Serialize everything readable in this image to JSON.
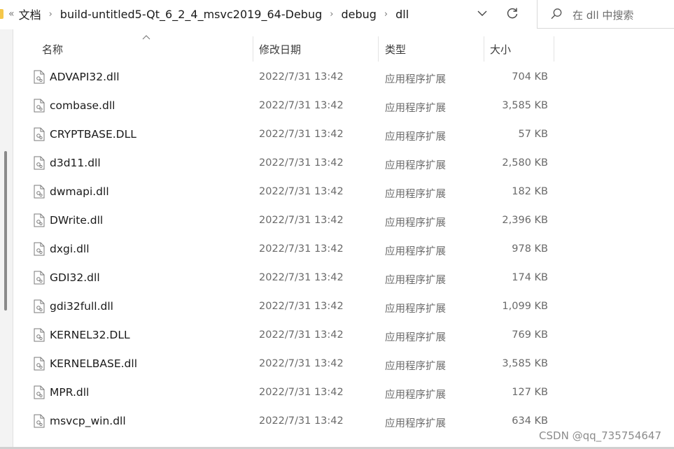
{
  "address": {
    "more": "«",
    "segments": [
      "文档",
      "build-untitled5-Qt_6_2_4_msvc2019_64-Debug",
      "debug",
      "dll"
    ]
  },
  "search": {
    "placeholder": "在 dll 中搜索"
  },
  "columns": {
    "name": "名称",
    "date": "修改日期",
    "type": "类型",
    "size": "大小"
  },
  "files": [
    {
      "name": "ADVAPI32.dll",
      "date": "2022/7/31 13:42",
      "type": "应用程序扩展",
      "size": "704 KB"
    },
    {
      "name": "combase.dll",
      "date": "2022/7/31 13:42",
      "type": "应用程序扩展",
      "size": "3,585 KB"
    },
    {
      "name": "CRYPTBASE.DLL",
      "date": "2022/7/31 13:42",
      "type": "应用程序扩展",
      "size": "57 KB"
    },
    {
      "name": "d3d11.dll",
      "date": "2022/7/31 13:42",
      "type": "应用程序扩展",
      "size": "2,580 KB"
    },
    {
      "name": "dwmapi.dll",
      "date": "2022/7/31 13:42",
      "type": "应用程序扩展",
      "size": "182 KB"
    },
    {
      "name": "DWrite.dll",
      "date": "2022/7/31 13:42",
      "type": "应用程序扩展",
      "size": "2,396 KB"
    },
    {
      "name": "dxgi.dll",
      "date": "2022/7/31 13:42",
      "type": "应用程序扩展",
      "size": "978 KB"
    },
    {
      "name": "GDI32.dll",
      "date": "2022/7/31 13:42",
      "type": "应用程序扩展",
      "size": "174 KB"
    },
    {
      "name": "gdi32full.dll",
      "date": "2022/7/31 13:42",
      "type": "应用程序扩展",
      "size": "1,099 KB"
    },
    {
      "name": "KERNEL32.DLL",
      "date": "2022/7/31 13:42",
      "type": "应用程序扩展",
      "size": "769 KB"
    },
    {
      "name": "KERNELBASE.dll",
      "date": "2022/7/31 13:42",
      "type": "应用程序扩展",
      "size": "3,585 KB"
    },
    {
      "name": "MPR.dll",
      "date": "2022/7/31 13:42",
      "type": "应用程序扩展",
      "size": "127 KB"
    },
    {
      "name": "msvcp_win.dll",
      "date": "2022/7/31 13:42",
      "type": "应用程序扩展",
      "size": "634 KB"
    }
  ],
  "watermark": "CSDN @qq_735754647",
  "icons": {
    "history": "chevron-down-icon",
    "refresh": "refresh-icon",
    "search": "search-icon",
    "file": "dll-file-icon",
    "sort": "sort-ascending-icon"
  },
  "colors": {
    "folder": "#f5c74a",
    "text_secondary": "#6a6a6a"
  }
}
